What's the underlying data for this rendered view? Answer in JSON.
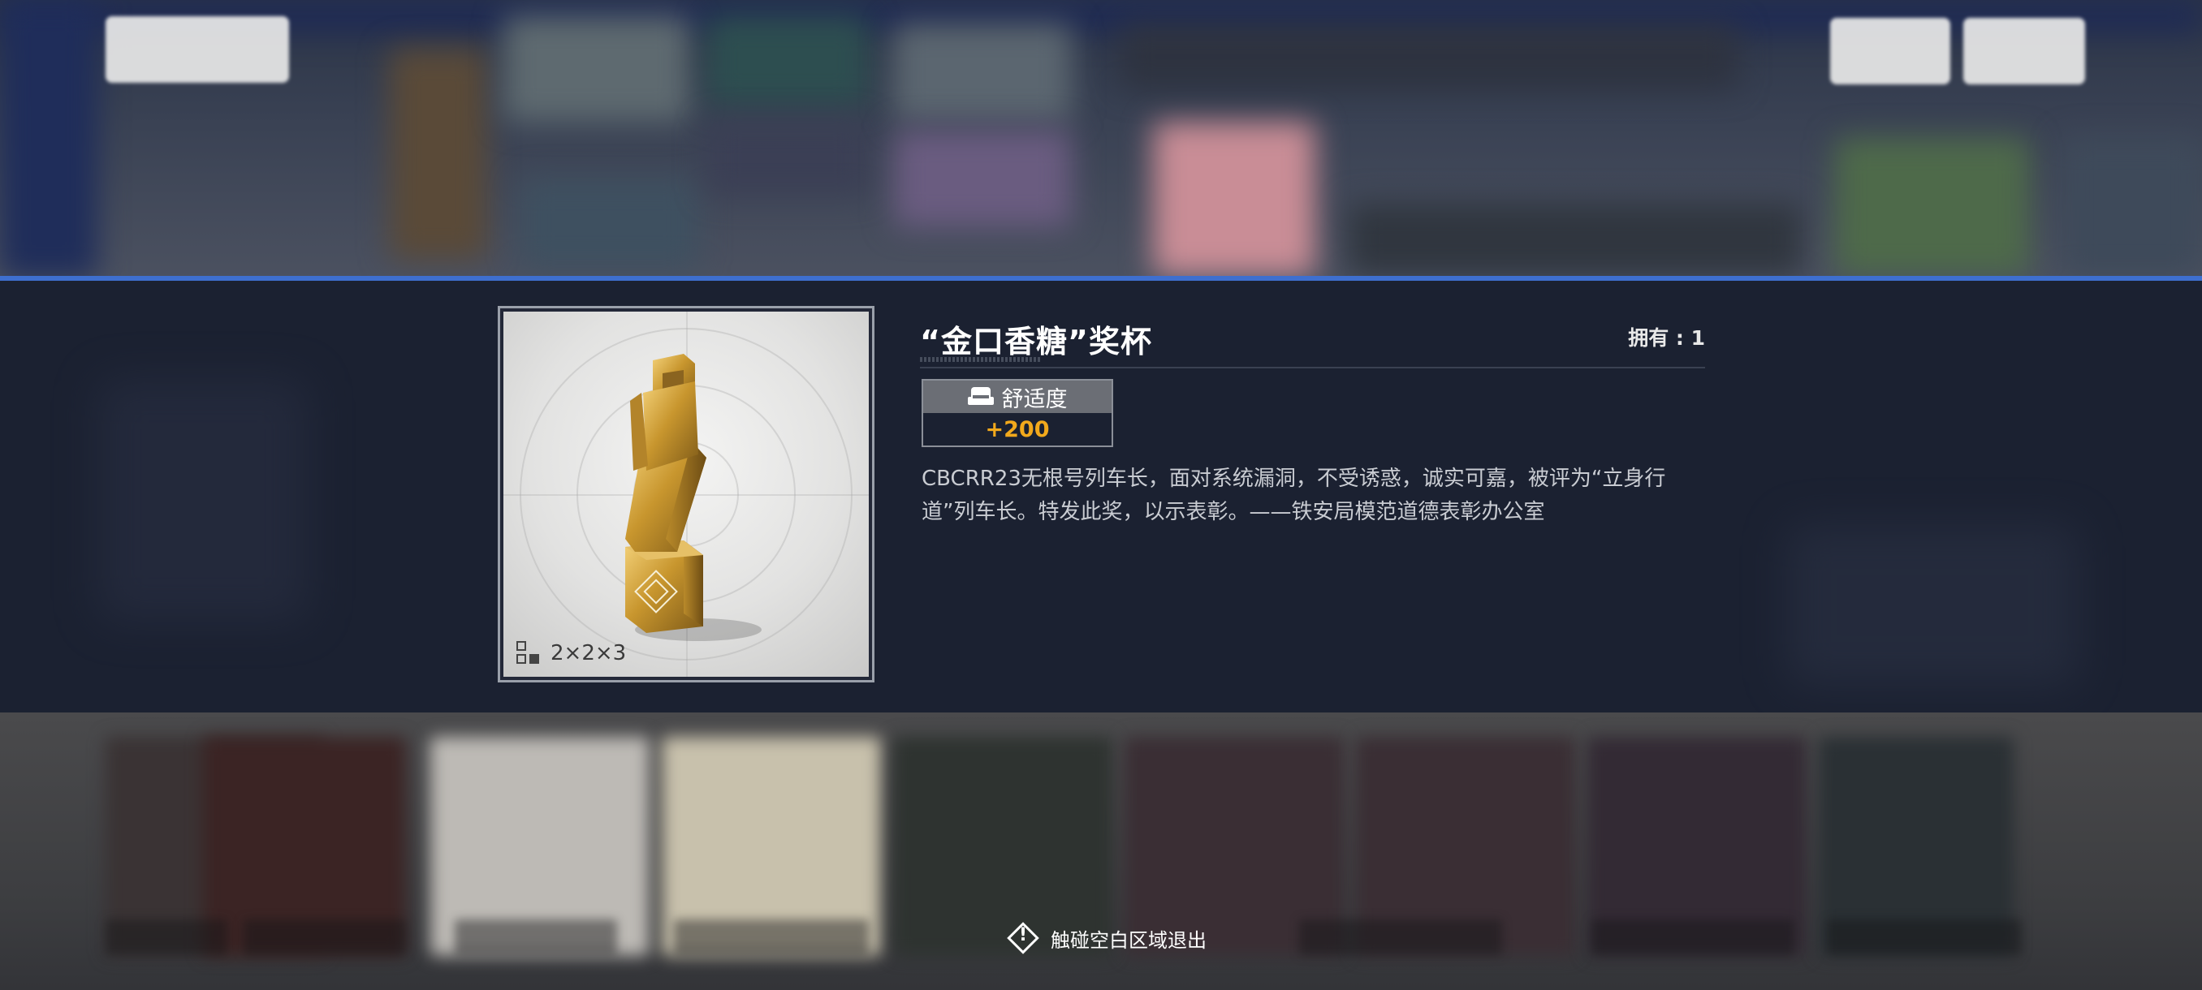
{
  "item": {
    "title": "“金口香糖”奖杯",
    "owned_label": "拥有 : 1",
    "stat_label": "舒适度",
    "stat_value": "+200",
    "size": "2×2×3",
    "description": "CBCRR23无根号列车长，面对系统漏洞，不受诱惑，诚实可嘉，被评为“立身行道”列车长。特发此奖，以示表彰。——铁安局模范道德表彰办公室"
  },
  "hint": {
    "text": "触碰空白区域退出"
  },
  "icons": {
    "stat": "sofa-icon",
    "size": "grid-size-icon",
    "hint": "warning-diamond-icon"
  },
  "colors": {
    "accent_line": "#3e6fcf",
    "stat_value": "#f2a91c",
    "panel": "#1b2131"
  }
}
